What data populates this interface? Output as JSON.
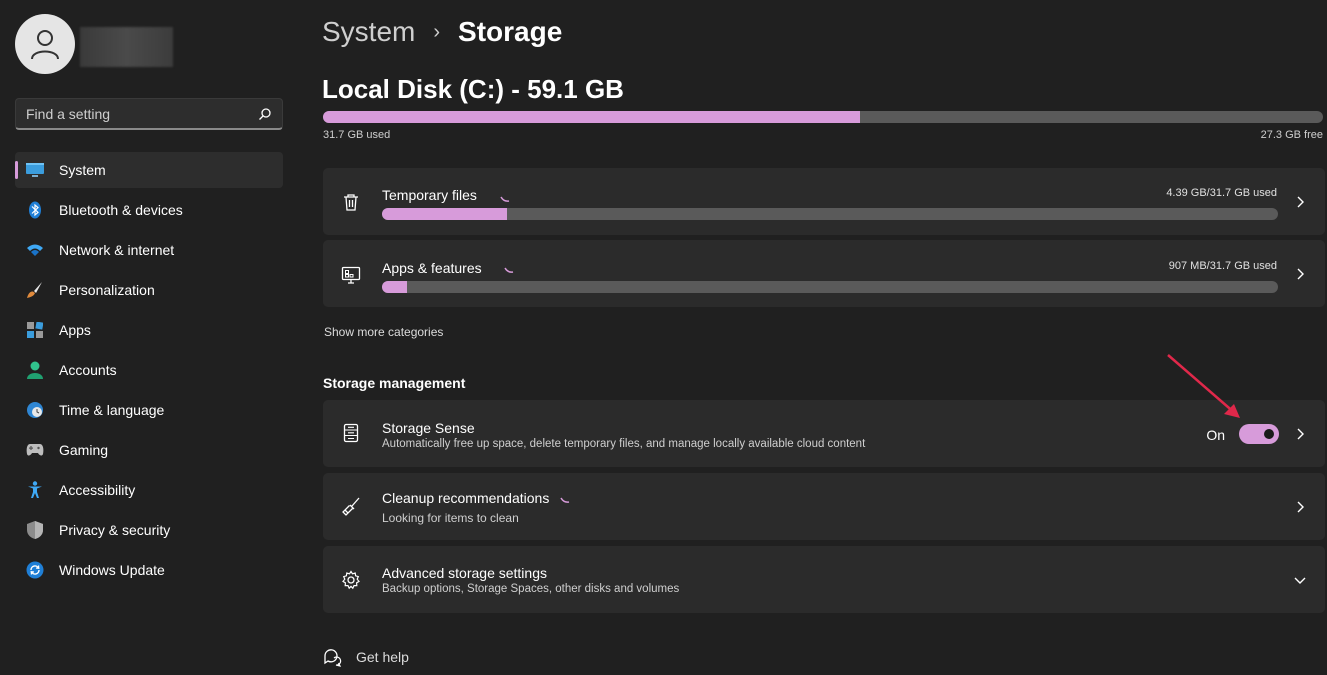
{
  "sidebar": {
    "search_placeholder": "Find a setting",
    "items": [
      {
        "label": "System",
        "icon": "monitor-icon",
        "active": true
      },
      {
        "label": "Bluetooth & devices",
        "icon": "bluetooth-icon"
      },
      {
        "label": "Network & internet",
        "icon": "wifi-icon"
      },
      {
        "label": "Personalization",
        "icon": "brush-icon"
      },
      {
        "label": "Apps",
        "icon": "apps-icon"
      },
      {
        "label": "Accounts",
        "icon": "person-icon"
      },
      {
        "label": "Time & language",
        "icon": "globe-clock-icon"
      },
      {
        "label": "Gaming",
        "icon": "gamepad-icon"
      },
      {
        "label": "Accessibility",
        "icon": "accessibility-icon"
      },
      {
        "label": "Privacy & security",
        "icon": "shield-icon"
      },
      {
        "label": "Windows Update",
        "icon": "update-icon"
      }
    ]
  },
  "header": {
    "breadcrumb_parent": "System",
    "breadcrumb_current": "Storage"
  },
  "disk": {
    "title": "Local Disk (C:) - 59.1 GB",
    "used_label": "31.7 GB used",
    "free_label": "27.3 GB free",
    "used_fraction": 0.537
  },
  "categories": [
    {
      "title": "Temporary files",
      "usage": "4.39 GB/31.7 GB used",
      "fraction": 0.139,
      "icon": "trash-icon"
    },
    {
      "title": "Apps & features",
      "usage": "907 MB/31.7 GB used",
      "fraction": 0.028,
      "icon": "apps-features-icon"
    }
  ],
  "show_more": "Show more categories",
  "storage_management": {
    "title": "Storage management",
    "storage_sense": {
      "title": "Storage Sense",
      "subtitle": "Automatically free up space, delete temporary files, and manage locally available cloud content",
      "toggle_label": "On",
      "toggle_on": true
    },
    "cleanup": {
      "title": "Cleanup recommendations",
      "subtitle": "Looking for items to clean"
    },
    "advanced": {
      "title": "Advanced storage settings",
      "subtitle": "Backup options, Storage Spaces, other disks and volumes"
    }
  },
  "help": {
    "label": "Get help"
  },
  "colors": {
    "accent": "#d79bda",
    "background": "#202020",
    "card": "#2b2b2b",
    "arrow": "#e0284a"
  }
}
